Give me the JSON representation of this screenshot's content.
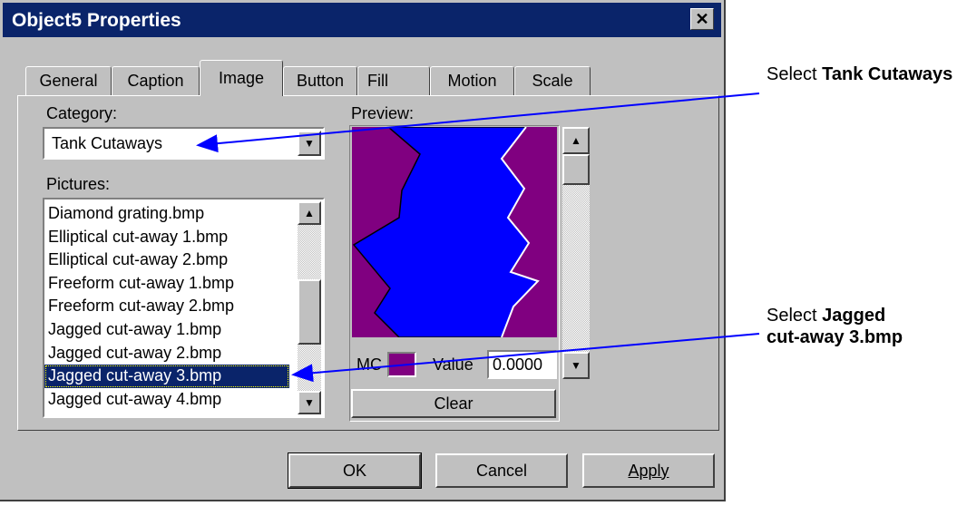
{
  "window": {
    "title": "Object5 Properties",
    "close_glyph": "✕"
  },
  "tabs": [
    {
      "label": "General"
    },
    {
      "label": "Caption"
    },
    {
      "label": "Image"
    },
    {
      "label": "Button"
    },
    {
      "label": "Fill"
    },
    {
      "label": "Motion"
    },
    {
      "label": "Scale"
    }
  ],
  "active_tab": "Image",
  "category": {
    "label": "Category:",
    "value": "Tank Cutaways"
  },
  "pictures": {
    "label": "Pictures:",
    "items": [
      "Diamond grating.bmp",
      "Elliptical cut-away 1.bmp",
      "Elliptical cut-away 2.bmp",
      "Freeform cut-away 1.bmp",
      "Freeform cut-away 2.bmp",
      "Jagged cut-away 1.bmp",
      "Jagged cut-away 2.bmp",
      "Jagged cut-away 3.bmp",
      "Jagged cut-away 4.bmp"
    ],
    "selected": "Jagged cut-away 3.bmp"
  },
  "preview": {
    "label": "Preview:",
    "mc_label": "MC",
    "mc_color": "#800080",
    "value_label": "Value",
    "value": "0.0000",
    "clear_label": "Clear",
    "colors": {
      "background": "#800080",
      "fill": "#0000ff"
    }
  },
  "buttons": {
    "ok": "OK",
    "cancel": "Cancel",
    "apply": "Apply"
  },
  "annotations": {
    "a1_prefix": "Select ",
    "a1_bold": "Tank Cutaways",
    "a2_prefix": "Select ",
    "a2_bold_1": "Jagged",
    "a2_bold_2": "cut-away 3.bmp",
    "arrow_color": "#0000ff"
  }
}
